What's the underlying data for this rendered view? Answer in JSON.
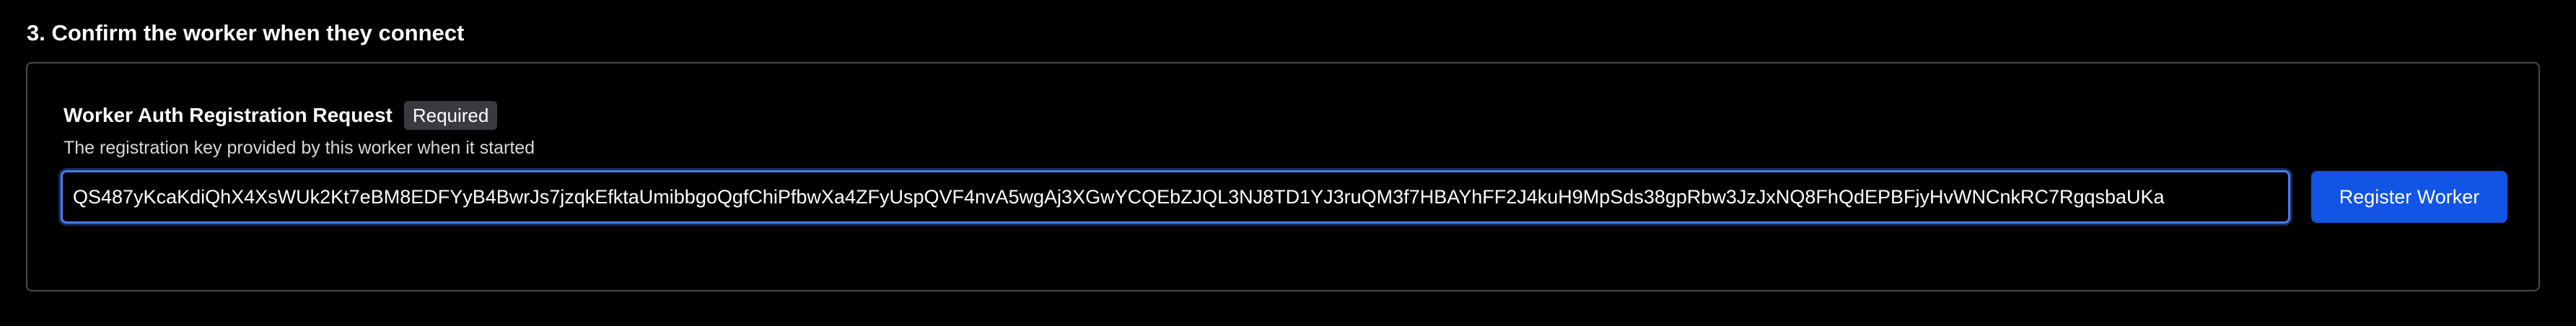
{
  "section": {
    "title": "3. Confirm the worker when they connect"
  },
  "field": {
    "label": "Worker Auth Registration Request",
    "badge": "Required",
    "help": "The registration key provided by this worker when it started",
    "value": "QS487yKcaKdiQhX4XsWUk2Kt7eBM8EDFYyB4BwrJs7jzqkEfktaUmibbgoQgfChiPfbwXa4ZFyUspQVF4nvA5wgAj3XGwYCQEbZJQL3NJ8TD1YJ3ruQM3f7HBAYhFF2J4kuH9MpSds38gpRbw3JzJxNQ8FhQdEPBFjyHvWNCnkRC7RgqsbaUKa"
  },
  "actions": {
    "register_label": "Register Worker"
  },
  "colors": {
    "background": "#000000",
    "card_border": "#4a4a4f",
    "input_focus": "#4a7bf7",
    "button": "#1254e3",
    "badge_bg": "#3a3b40"
  }
}
